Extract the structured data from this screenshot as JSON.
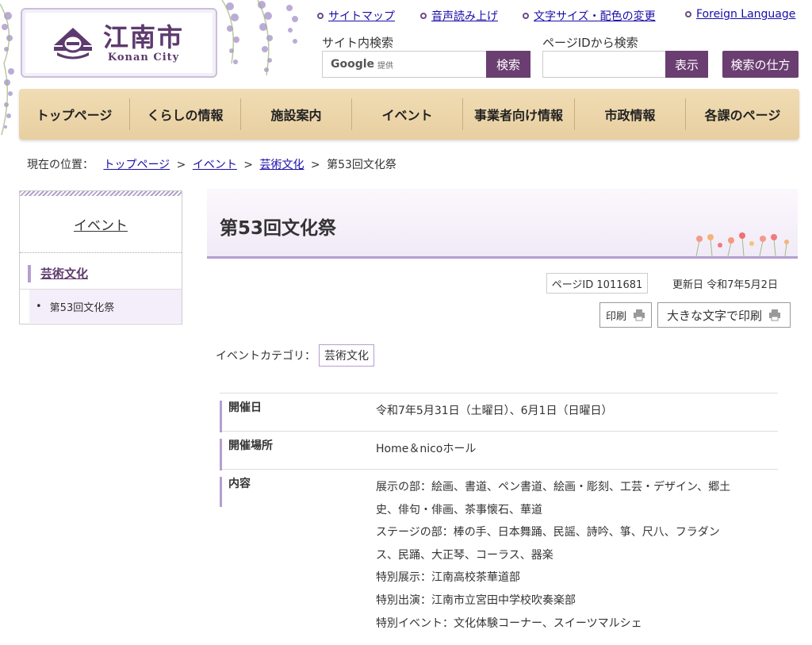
{
  "site": {
    "logo_jp": "江南市",
    "logo_en": "Konan City"
  },
  "toplinks": [
    {
      "label": "サイトマップ"
    },
    {
      "label": "音声読み上げ"
    },
    {
      "label": "文字サイズ・配色の変更"
    },
    {
      "label": "Foreign Language"
    }
  ],
  "search": {
    "site_label": "サイト内検索",
    "google_brand": "Google",
    "google_sub": "提供",
    "site_button": "検索",
    "id_label": "ページIDから検索",
    "id_placeholder": "",
    "id_button": "表示",
    "help_button": "検索の仕方"
  },
  "nav": [
    {
      "label": "トップページ"
    },
    {
      "label": "くらしの情報"
    },
    {
      "label": "施設案内"
    },
    {
      "label": "イベント"
    },
    {
      "label": "事業者向け情報"
    },
    {
      "label": "市政情報"
    },
    {
      "label": "各課のページ"
    }
  ],
  "breadcrumb": {
    "prefix": "現在の位置：",
    "sep": ">",
    "links": [
      "トップページ",
      "イベント",
      "芸術文化"
    ],
    "current": "第53回文化祭"
  },
  "sidebar": {
    "title": "イベント",
    "category": "芸術文化",
    "bullet": "•",
    "item": "第53回文化祭"
  },
  "main": {
    "title": "第53回文化祭",
    "page_id": "ページID 1011681",
    "updated": "更新日 令和7年5月2日",
    "print": "印刷",
    "print_large": "大きな文字で印刷",
    "event_category_label": "イベントカテゴリ：",
    "event_category": "芸術文化",
    "rows": [
      {
        "label": "開催日",
        "lines": [
          "令和7年5月31日（土曜日）、6月1日（日曜日）"
        ]
      },
      {
        "label": "開催場所",
        "lines": [
          "Home＆nicoホール"
        ]
      },
      {
        "label": "内容",
        "lines": [
          "展示の部：絵画、書道、ペン書道、絵画・彫刻、工芸・デザイン、郷土",
          "史、俳句・俳画、茶事懐石、華道",
          "ステージの部：棒の手、日本舞踊、民謡、詩吟、箏、尺八、フラダン",
          "ス、民踊、大正琴、コーラス、器楽",
          "特別展示：江南高校茶華道部",
          "特別出演：江南市立宮田中学校吹奏楽部",
          "特別イベント：文化体験コーナー、スイーツマルシェ"
        ]
      }
    ]
  },
  "colors": {
    "brand_purple": "#6b3e72",
    "accent_lavender": "#b59ed0",
    "nav_wood": "#ecd5a8",
    "link": "#1a0dab"
  }
}
